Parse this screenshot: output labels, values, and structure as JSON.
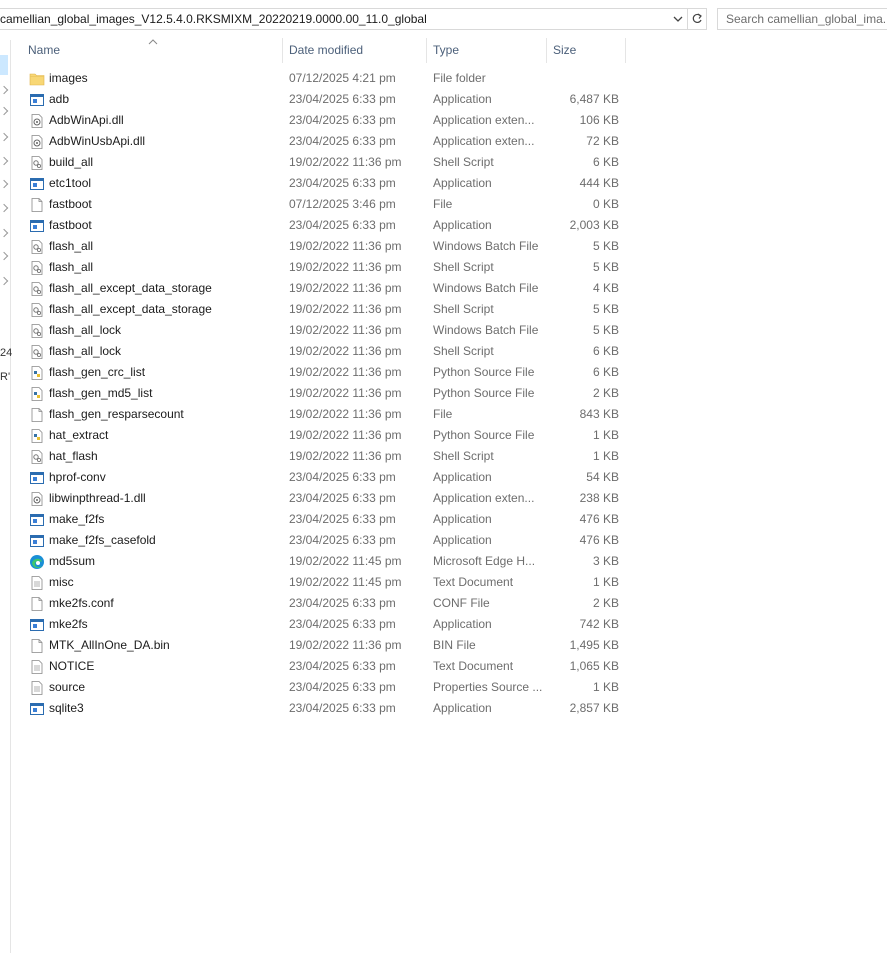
{
  "address_bar": {
    "path": "camellian_global_images_V12.5.4.0.RKSMIXM_20220219.0000.00_11.0_global",
    "search_placeholder": "Search camellian_global_ima..."
  },
  "nav_fragments": [
    "24",
    "R'"
  ],
  "columns": {
    "name": "Name",
    "date": "Date modified",
    "type": "Type",
    "size": "Size"
  },
  "files": [
    {
      "name": "images",
      "date": "07/12/2025 4:21 pm",
      "type": "File folder",
      "size": "",
      "icon": "folder-icon"
    },
    {
      "name": "adb",
      "date": "23/04/2025 6:33 pm",
      "type": "Application",
      "size": "6,487 KB",
      "icon": "app-icon"
    },
    {
      "name": "AdbWinApi.dll",
      "date": "23/04/2025 6:33 pm",
      "type": "Application exten...",
      "size": "106 KB",
      "icon": "dll-icon"
    },
    {
      "name": "AdbWinUsbApi.dll",
      "date": "23/04/2025 6:33 pm",
      "type": "Application exten...",
      "size": "72 KB",
      "icon": "dll-icon"
    },
    {
      "name": "build_all",
      "date": "19/02/2022 11:36 pm",
      "type": "Shell Script",
      "size": "6 KB",
      "icon": "script-icon"
    },
    {
      "name": "etc1tool",
      "date": "23/04/2025 6:33 pm",
      "type": "Application",
      "size": "444 KB",
      "icon": "app-icon"
    },
    {
      "name": "fastboot",
      "date": "07/12/2025 3:46 pm",
      "type": "File",
      "size": "0 KB",
      "icon": "file-icon"
    },
    {
      "name": "fastboot",
      "date": "23/04/2025 6:33 pm",
      "type": "Application",
      "size": "2,003 KB",
      "icon": "app-icon"
    },
    {
      "name": "flash_all",
      "date": "19/02/2022 11:36 pm",
      "type": "Windows Batch File",
      "size": "5 KB",
      "icon": "script-icon"
    },
    {
      "name": "flash_all",
      "date": "19/02/2022 11:36 pm",
      "type": "Shell Script",
      "size": "5 KB",
      "icon": "script-icon"
    },
    {
      "name": "flash_all_except_data_storage",
      "date": "19/02/2022 11:36 pm",
      "type": "Windows Batch File",
      "size": "4 KB",
      "icon": "script-icon"
    },
    {
      "name": "flash_all_except_data_storage",
      "date": "19/02/2022 11:36 pm",
      "type": "Shell Script",
      "size": "5 KB",
      "icon": "script-icon"
    },
    {
      "name": "flash_all_lock",
      "date": "19/02/2022 11:36 pm",
      "type": "Windows Batch File",
      "size": "5 KB",
      "icon": "script-icon"
    },
    {
      "name": "flash_all_lock",
      "date": "19/02/2022 11:36 pm",
      "type": "Shell Script",
      "size": "6 KB",
      "icon": "script-icon"
    },
    {
      "name": "flash_gen_crc_list",
      "date": "19/02/2022 11:36 pm",
      "type": "Python Source File",
      "size": "6 KB",
      "icon": "python-icon"
    },
    {
      "name": "flash_gen_md5_list",
      "date": "19/02/2022 11:36 pm",
      "type": "Python Source File",
      "size": "2 KB",
      "icon": "python-icon"
    },
    {
      "name": "flash_gen_resparsecount",
      "date": "19/02/2022 11:36 pm",
      "type": "File",
      "size": "843 KB",
      "icon": "file-icon"
    },
    {
      "name": "hat_extract",
      "date": "19/02/2022 11:36 pm",
      "type": "Python Source File",
      "size": "1 KB",
      "icon": "python-icon"
    },
    {
      "name": "hat_flash",
      "date": "19/02/2022 11:36 pm",
      "type": "Shell Script",
      "size": "1 KB",
      "icon": "script-icon"
    },
    {
      "name": "hprof-conv",
      "date": "23/04/2025 6:33 pm",
      "type": "Application",
      "size": "54 KB",
      "icon": "app-icon"
    },
    {
      "name": "libwinpthread-1.dll",
      "date": "23/04/2025 6:33 pm",
      "type": "Application exten...",
      "size": "238 KB",
      "icon": "dll-icon"
    },
    {
      "name": "make_f2fs",
      "date": "23/04/2025 6:33 pm",
      "type": "Application",
      "size": "476 KB",
      "icon": "app-icon"
    },
    {
      "name": "make_f2fs_casefold",
      "date": "23/04/2025 6:33 pm",
      "type": "Application",
      "size": "476 KB",
      "icon": "app-icon"
    },
    {
      "name": "md5sum",
      "date": "19/02/2022 11:45 pm",
      "type": "Microsoft Edge H...",
      "size": "3 KB",
      "icon": "edge-icon"
    },
    {
      "name": "misc",
      "date": "19/02/2022 11:45 pm",
      "type": "Text Document",
      "size": "1 KB",
      "icon": "text-icon"
    },
    {
      "name": "mke2fs.conf",
      "date": "23/04/2025 6:33 pm",
      "type": "CONF File",
      "size": "2 KB",
      "icon": "file-icon"
    },
    {
      "name": "mke2fs",
      "date": "23/04/2025 6:33 pm",
      "type": "Application",
      "size": "742 KB",
      "icon": "app-icon"
    },
    {
      "name": "MTK_AllInOne_DA.bin",
      "date": "19/02/2022 11:36 pm",
      "type": "BIN File",
      "size": "1,495 KB",
      "icon": "file-icon"
    },
    {
      "name": "NOTICE",
      "date": "23/04/2025 6:33 pm",
      "type": "Text Document",
      "size": "1,065 KB",
      "icon": "text-icon"
    },
    {
      "name": "source",
      "date": "23/04/2025 6:33 pm",
      "type": "Properties Source ...",
      "size": "1 KB",
      "icon": "text-icon"
    },
    {
      "name": "sqlite3",
      "date": "23/04/2025 6:33 pm",
      "type": "Application",
      "size": "2,857 KB",
      "icon": "app-icon"
    }
  ]
}
